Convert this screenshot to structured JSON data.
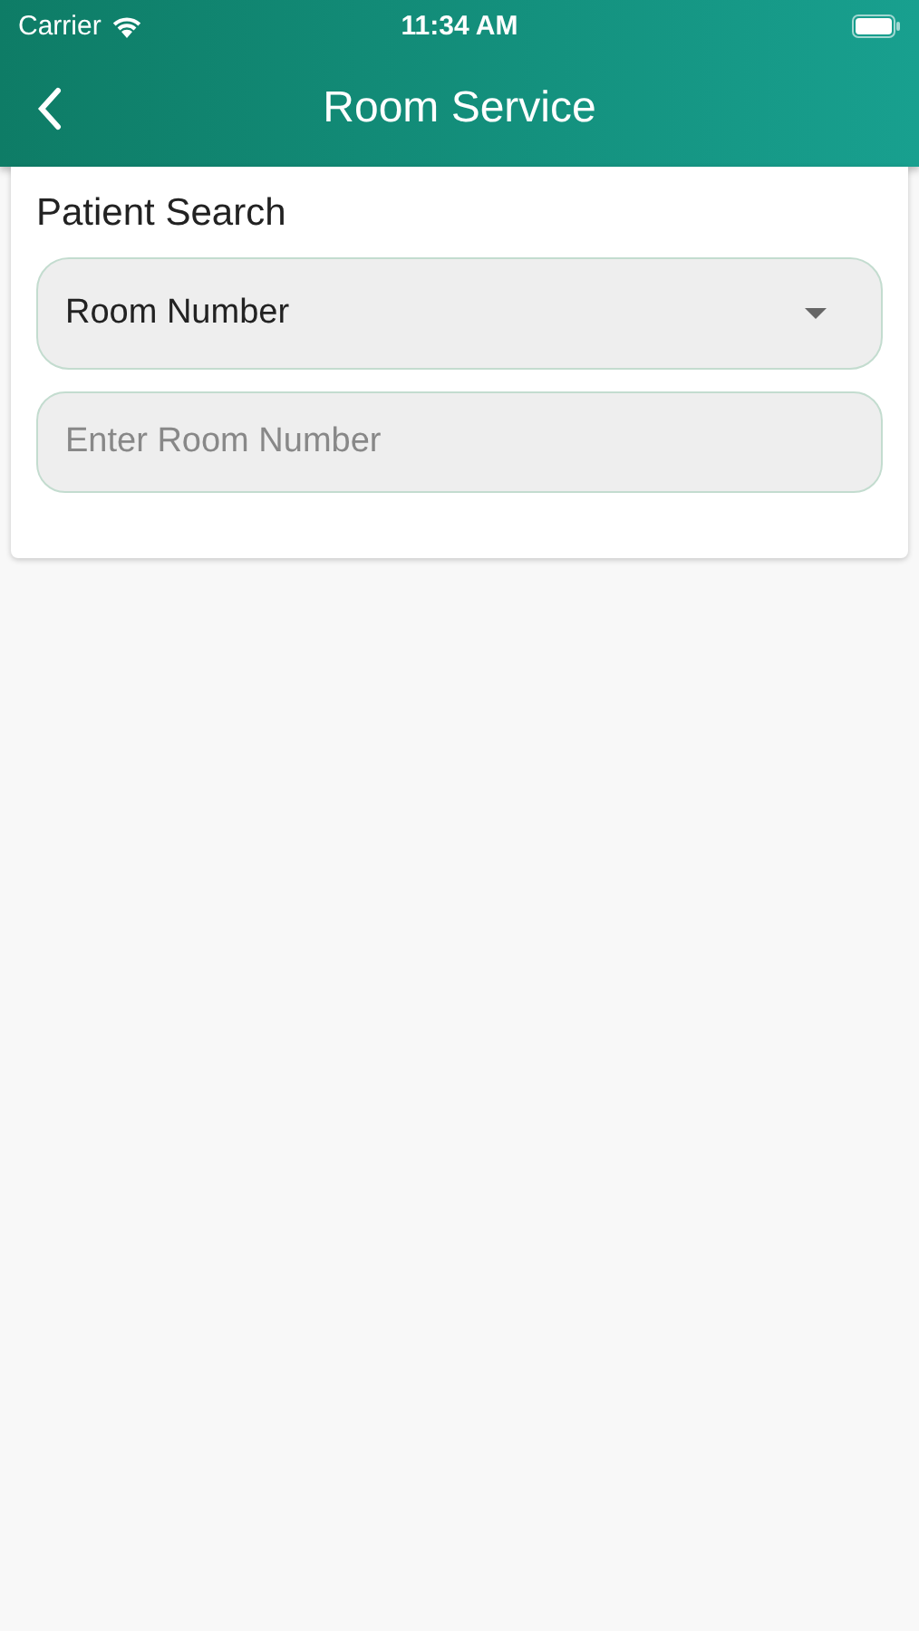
{
  "status_bar": {
    "carrier": "Carrier",
    "time": "11:34 AM"
  },
  "header": {
    "title": "Room Service"
  },
  "patient_search": {
    "title": "Patient Search",
    "dropdown": {
      "value": "Room Number"
    },
    "room_field": {
      "placeholder": "Enter Room Number"
    }
  }
}
